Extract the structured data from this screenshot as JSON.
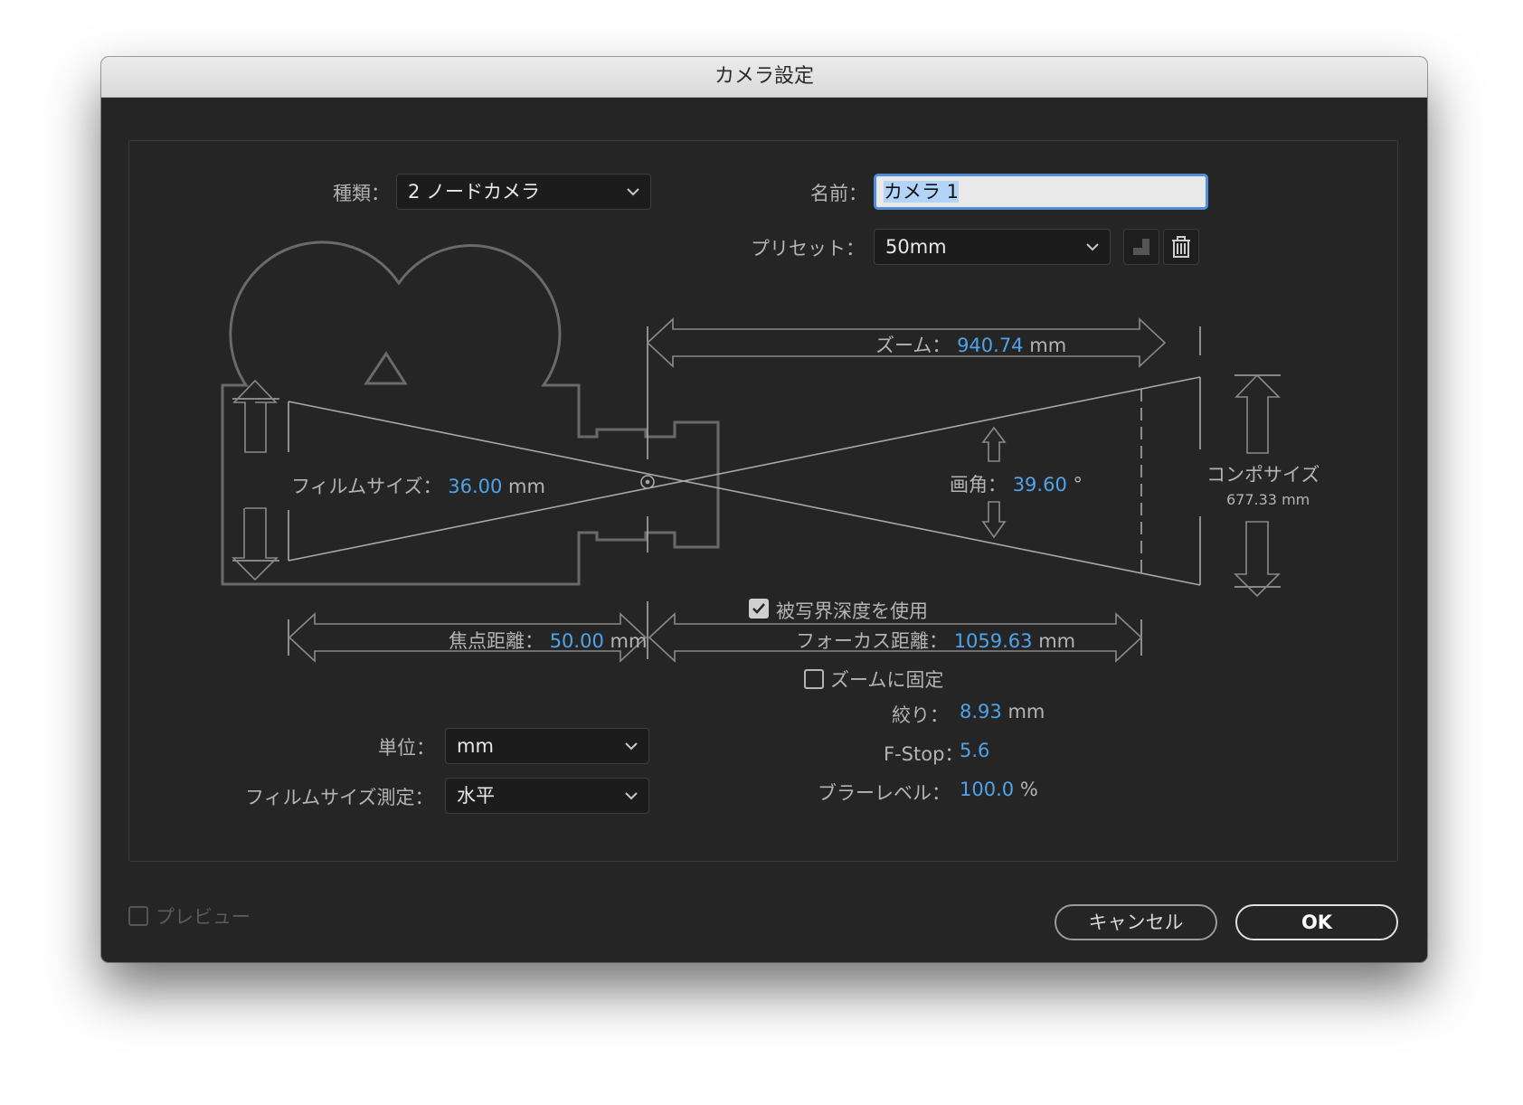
{
  "window": {
    "title": "カメラ設定"
  },
  "type": {
    "label": "種類：",
    "value": "2 ノードカメラ"
  },
  "name": {
    "label": "名前：",
    "value": "カメラ 1"
  },
  "preset": {
    "label": "プリセット：",
    "value": "50mm"
  },
  "zoom": {
    "label": "ズーム：",
    "value": "940.74",
    "unit": "mm"
  },
  "film_size": {
    "label": "フィルムサイズ：",
    "value": "36.00",
    "unit": "mm"
  },
  "angle": {
    "label": "画角：",
    "value": "39.60",
    "unit": "°"
  },
  "comp_size": {
    "label": "コンポサイズ",
    "value": "677.33 mm"
  },
  "depth_of_field": {
    "label": "被写界深度を使用",
    "checked": true
  },
  "focal_length": {
    "label": "焦点距離：",
    "value": "50.00",
    "unit": "mm"
  },
  "focus_distance": {
    "label": "フォーカス距離：",
    "value": "1059.63",
    "unit": "mm"
  },
  "lock_to_zoom": {
    "label": "ズームに固定",
    "checked": false
  },
  "aperture": {
    "label": "絞り：",
    "value": "8.93",
    "unit": "mm"
  },
  "fstop": {
    "label": "F-Stop：",
    "value": "5.6"
  },
  "blur_level": {
    "label": "ブラーレベル：",
    "value": "100.0",
    "unit": "%"
  },
  "units": {
    "label": "単位：",
    "value": "mm"
  },
  "film_measure": {
    "label": "フィルムサイズ測定：",
    "value": "水平"
  },
  "preview": {
    "label": "プレビュー",
    "checked": false
  },
  "buttons": {
    "cancel": "キャンセル",
    "ok": "OK"
  },
  "colors": {
    "accent": "#4fa3ea",
    "background": "#252525",
    "line": "#6a6a6a"
  },
  "icons": {
    "save_preset": "save-preset-icon",
    "delete_preset": "trash-icon",
    "dropdown": "chevron-down-icon"
  }
}
